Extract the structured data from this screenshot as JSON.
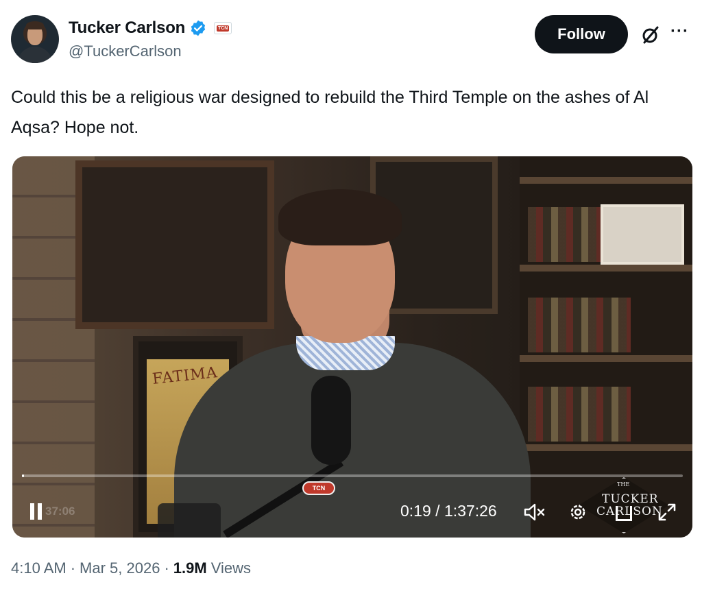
{
  "author": {
    "name": "Tucker Carlson",
    "handle": "@TuckerCarlson",
    "affiliation_badge": "TCN",
    "verified": true,
    "verified_color": "#1d9bf0"
  },
  "actions": {
    "follow_label": "Follow",
    "grok_icon": "grok-icon",
    "more_icon": "more-options-icon",
    "more_glyph": "···"
  },
  "tweet": {
    "text": "Could this be a religious war designed to rebuild the Third Temple on the ashes of Al Aqsa? Hope not."
  },
  "video": {
    "scene": {
      "poster_text": "FATIMA",
      "mic_badge": "TCN",
      "watermark_small": "THE",
      "watermark_line1": "TUCKER",
      "watermark_line2": "CARLSON"
    },
    "controls": {
      "ghost_time": "37:06",
      "current_time": "0:19",
      "separator": " / ",
      "duration": "1:37:26",
      "progress_fraction": 0.0033,
      "state": "playing",
      "pause_icon": "pause-icon",
      "mute_icon": "mute-icon",
      "settings_icon": "settings-icon",
      "expand_icon": "expand-icon"
    }
  },
  "meta": {
    "time": "4:10 AM",
    "dot1": "·",
    "date": "Mar 5, 2026",
    "dot2": "·",
    "views_count": "1.9M",
    "views_label": "Views"
  }
}
